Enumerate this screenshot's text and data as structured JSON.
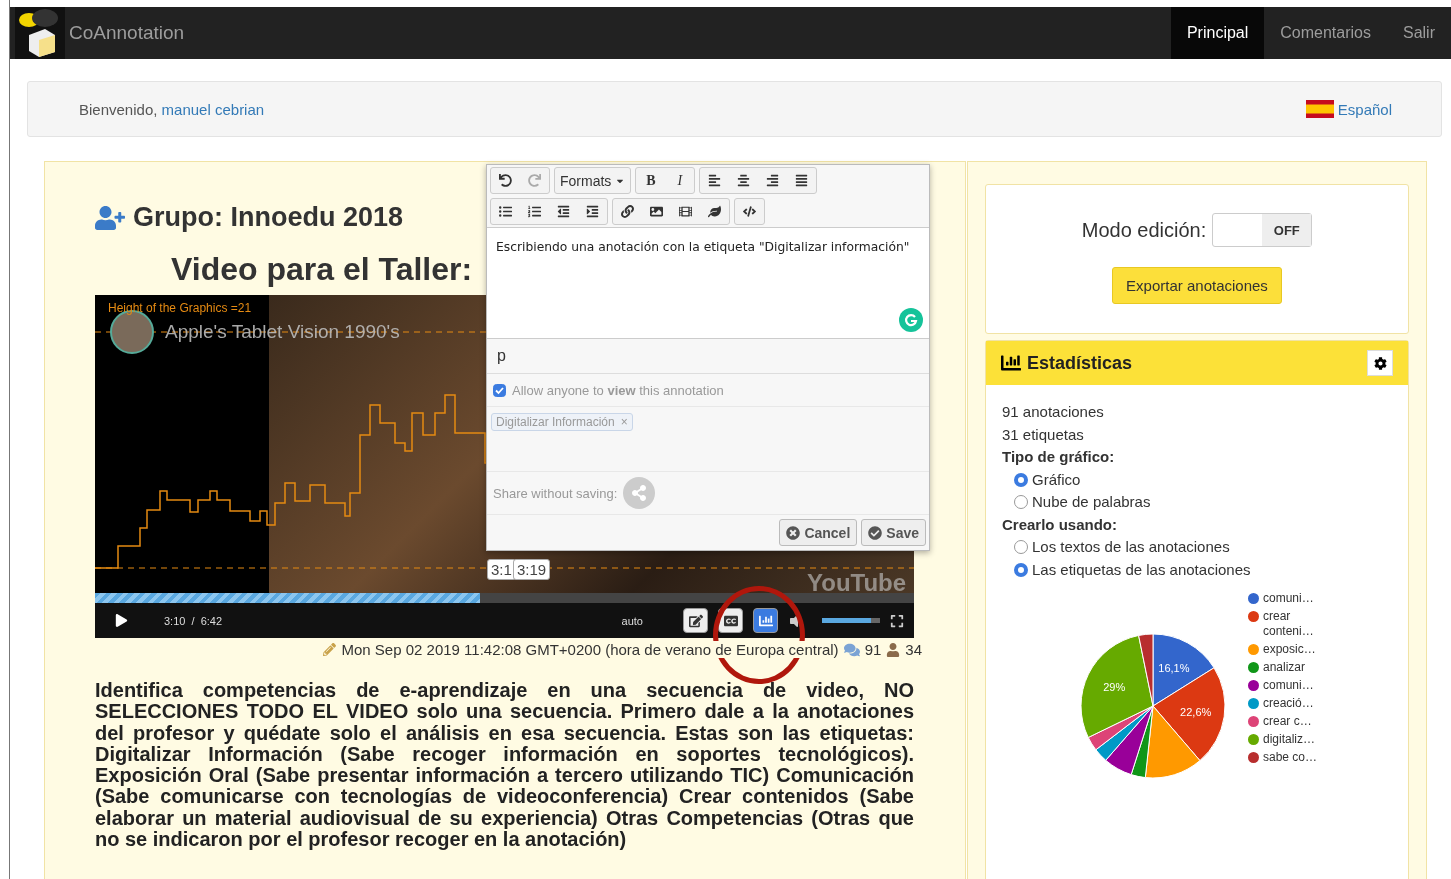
{
  "navbar": {
    "brand": "CoAnnotation",
    "links": [
      {
        "label": "Principal",
        "selected": true
      },
      {
        "label": "Comentarios",
        "selected": false
      },
      {
        "label": "Salir",
        "selected": false
      }
    ]
  },
  "welcome": {
    "greeting": "Bienvenido,",
    "user": "manuel cebrian",
    "language": "Español"
  },
  "group": {
    "title": "Grupo: Innoedu 2018",
    "video_heading": "Video para el Taller:"
  },
  "video": {
    "overlay_label": "Height of the Graphics =21",
    "title": "Apple's Tablet Vision 1990's",
    "current_time": "3:10",
    "separator": "/",
    "duration": "6:42",
    "quality": "auto",
    "logo": "YouTube",
    "progress": {
      "level": 0.47
    },
    "volume": {
      "level": 0.85
    },
    "markers": [
      "3:1",
      "3:19"
    ],
    "tools": [
      {
        "kind": "edit",
        "selected": false
      },
      {
        "kind": "subtitles",
        "selected": false
      },
      {
        "kind": "stats",
        "selected": true
      }
    ]
  },
  "meta": {
    "date": "Mon Sep 02 2019 11:42:08 GMT+0200 (hora de verano de Europa central)",
    "comments": "91",
    "users": "34"
  },
  "description": "Identifica competencias de e-aprendizaje en una secuencia de video, NO SELECCIONES TODO EL VIDEO solo una secuencia. Primero dale a la anotaciones del profesor y quédate solo el análisis en esa secuencia. Estas son las etiquetas: Digitalizar Información (Sabe recoger información en soportes tecnológicos). Exposición Oral (Sabe presentar información a tercero utilizando TIC) Comunicación (Sabe comunicarse con tecnologías de videoconferencia) Crear contenidos (Sabe elaborar un material audiovisual de su experiencia) Otras Competencias (Otras que no se indicaron por el profesor recoger en la anotación)",
  "editor": {
    "toolbar": [
      [
        [
          {
            "kind": "undo",
            "disabled": false
          },
          {
            "kind": "redo",
            "disabled": true
          }
        ],
        [
          {
            "kind": "dropdown",
            "label": "Formats"
          }
        ],
        [
          {
            "kind": "bold",
            "label": "B"
          },
          {
            "kind": "italic",
            "label": "I"
          }
        ],
        [
          {
            "kind": "align-left"
          },
          {
            "kind": "align-center"
          },
          {
            "kind": "align-right"
          },
          {
            "kind": "align-justify"
          }
        ]
      ],
      [
        [
          {
            "kind": "bullet-list"
          },
          {
            "kind": "numbered-list"
          },
          {
            "kind": "outdent"
          },
          {
            "kind": "indent"
          }
        ],
        [
          {
            "kind": "link"
          },
          {
            "kind": "image"
          },
          {
            "kind": "video"
          },
          {
            "kind": "plugin"
          }
        ],
        [
          {
            "kind": "code"
          }
        ]
      ]
    ],
    "content": "Escribiendo una anotación con la etiqueta \"Digitalizar información\"",
    "path": "p",
    "permission": {
      "label": "Allow anyone to **view** this annotation",
      "checked": true
    },
    "tags": [
      {
        "label": "Digitalizar Información",
        "remove": "×"
      }
    ],
    "share_label": "Share without saving:",
    "buttons": [
      {
        "kind": "cancel",
        "label": "Cancel"
      },
      {
        "kind": "save",
        "label": "Save"
      }
    ]
  },
  "mode": {
    "label": "Modo edición:",
    "switch_label": "OFF",
    "on": false
  },
  "export_button": "Exportar anotaciones",
  "stats": {
    "title": "Estadísticas",
    "annotations": "91 anotaciones",
    "tags": "31 etiquetas",
    "chart_type": {
      "label": "Tipo de gráfico:",
      "options": [
        {
          "label": "Gráfico",
          "selected": true
        },
        {
          "label": "Nube de palabras",
          "selected": false
        }
      ]
    },
    "source": {
      "label": "Crearlo usando:",
      "options": [
        {
          "label": "Los textos de las anotaciones",
          "selected": false
        },
        {
          "label": "Las etiquetas de las anotaciones",
          "selected": true
        }
      ]
    },
    "chart_data": {
      "type": "pie",
      "categories": [
        "comuni…",
        "crear conteni…",
        "exposic…",
        "analizar",
        "comuni…",
        "creació…",
        "crear c…",
        "digitaliz…",
        "sabe co…"
      ],
      "series": [
        {
          "values": [
            16.1,
            22.6,
            13,
            3.2,
            6.5,
            3.2,
            3.2,
            29,
            3.2
          ]
        }
      ],
      "legend": "right",
      "colors": [
        "#3366cc",
        "#dc3912",
        "#ff9900",
        "#109618",
        "#990099",
        "#0099c6",
        "#dd4477",
        "#66aa00",
        "#b82e2e"
      ],
      "value_labels": [
        "16,1%",
        "22,6%",
        null,
        null,
        null,
        null,
        null,
        "29%",
        null
      ]
    }
  }
}
